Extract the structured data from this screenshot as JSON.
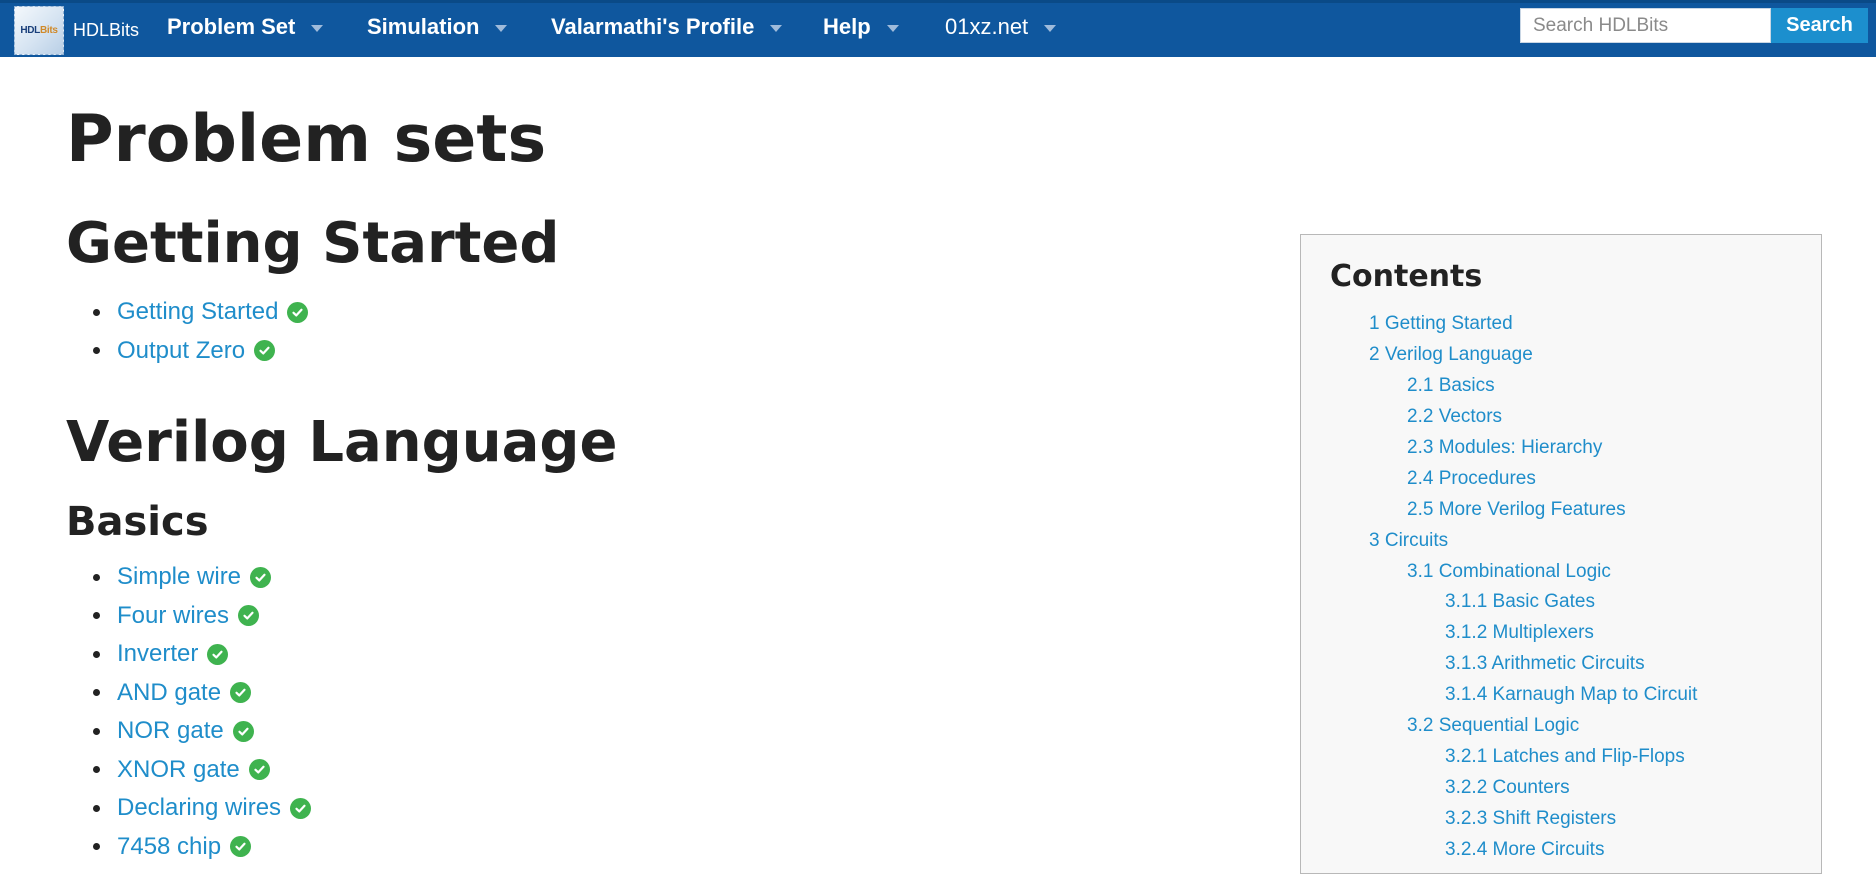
{
  "nav": {
    "logo_part1": "HDL",
    "logo_part2": "Bits",
    "site_name": "HDLBits",
    "menu": [
      {
        "label": "Problem Set"
      },
      {
        "label": "Simulation"
      },
      {
        "label": "Valarmathi's Profile"
      },
      {
        "label": "Help"
      },
      {
        "label": "01xz.net"
      }
    ],
    "search_placeholder": "Search HDLBits",
    "search_button": "Search"
  },
  "main": {
    "title": "Problem sets",
    "sections": [
      {
        "heading": "Getting Started",
        "items": [
          "Getting Started",
          "Output Zero"
        ]
      },
      {
        "heading": "Verilog Language",
        "subheading": "Basics",
        "items": [
          "Simple wire",
          "Four wires",
          "Inverter",
          "AND gate",
          "NOR gate",
          "XNOR gate",
          "Declaring wires",
          "7458 chip"
        ]
      }
    ]
  },
  "toc": {
    "title": "Contents",
    "items": [
      {
        "label": "1 Getting Started",
        "level": 1
      },
      {
        "label": "2 Verilog Language",
        "level": 1
      },
      {
        "label": "2.1 Basics",
        "level": 2
      },
      {
        "label": "2.2 Vectors",
        "level": 2
      },
      {
        "label": "2.3 Modules: Hierarchy",
        "level": 2
      },
      {
        "label": "2.4 Procedures",
        "level": 2
      },
      {
        "label": "2.5 More Verilog Features",
        "level": 2
      },
      {
        "label": "3 Circuits",
        "level": 1
      },
      {
        "label": "3.1 Combinational Logic",
        "level": 2
      },
      {
        "label": "3.1.1 Basic Gates",
        "level": 3
      },
      {
        "label": "3.1.2 Multiplexers",
        "level": 3
      },
      {
        "label": "3.1.3 Arithmetic Circuits",
        "level": 3
      },
      {
        "label": "3.1.4 Karnaugh Map to Circuit",
        "level": 3
      },
      {
        "label": "3.2 Sequential Logic",
        "level": 2
      },
      {
        "label": "3.2.1 Latches and Flip-Flops",
        "level": 3
      },
      {
        "label": "3.2.2 Counters",
        "level": 3
      },
      {
        "label": "3.2.3 Shift Registers",
        "level": 3
      },
      {
        "label": "3.2.4 More Circuits",
        "level": 3
      }
    ]
  },
  "colors": {
    "nav_bg": "#0f579e",
    "link": "#1f8dca",
    "check": "#3fb34f",
    "search_button": "#1c8fce"
  }
}
